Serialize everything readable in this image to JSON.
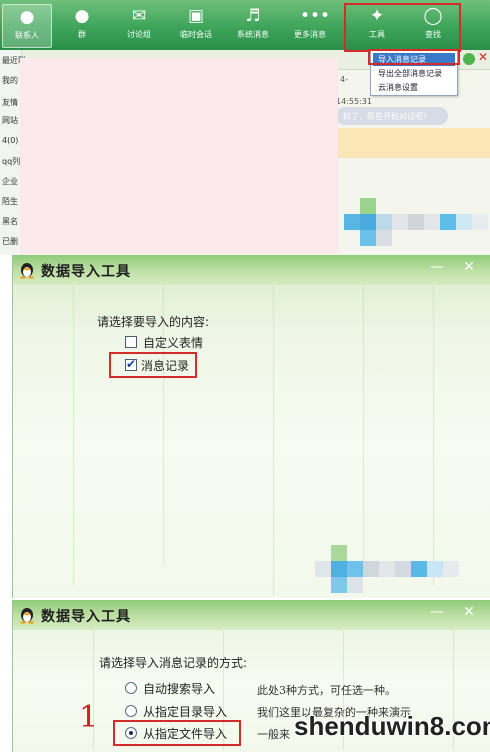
{
  "toolbar": {
    "items": [
      {
        "label": "联系人",
        "icon": "person-icon"
      },
      {
        "label": "群",
        "icon": "group-icon"
      },
      {
        "label": "讨论组",
        "icon": "discussion-icon"
      },
      {
        "label": "临时会话",
        "icon": "temp-chat-icon"
      },
      {
        "label": "系统消息",
        "icon": "speaker-icon"
      },
      {
        "label": "更多消息",
        "icon": "more-icon"
      },
      {
        "label": "工具",
        "icon": "wrench-icon"
      },
      {
        "label": "查找",
        "icon": "search-icon"
      }
    ]
  },
  "tools_menu": {
    "items": [
      "导入消息记录",
      "导出全部消息记录",
      "云消息设置"
    ],
    "selected": "导入消息记录"
  },
  "contact_list": {
    "items": [
      "最近联",
      "我的",
      "友情",
      "网站",
      "4(0)",
      "qq列",
      "企业",
      "陌生",
      "黑名",
      "已删"
    ]
  },
  "chat": {
    "fragment_1": "4-",
    "timestamp": "14:55:31",
    "system_message": "好了，现在开始对话吧！"
  },
  "dialog1": {
    "title": "数据导入工具",
    "prompt": "请选择要导入的内容:",
    "options": [
      {
        "label": "自定义表情",
        "checked": false
      },
      {
        "label": "消息记录",
        "checked": true
      }
    ]
  },
  "dialog2": {
    "title": "数据导入工具",
    "prompt": "请选择导入消息记录的方式:",
    "step_number": "1",
    "options": [
      {
        "label": "自动搜索导入",
        "selected": false
      },
      {
        "label": "从指定目录导入",
        "selected": false
      },
      {
        "label": "从指定文件导入",
        "selected": true
      }
    ],
    "notes": [
      "此处3种方式，可任选一种。",
      "我们这里以最复杂的一种来演示",
      "一般来"
    ]
  },
  "window_controls": {
    "minimize": "—",
    "close": "✕"
  },
  "watermark": "shenduwin8.com",
  "colors": {
    "qq_green": "#3ea45a",
    "highlight_red": "#d62b2b",
    "menu_select": "#3a78c8"
  }
}
